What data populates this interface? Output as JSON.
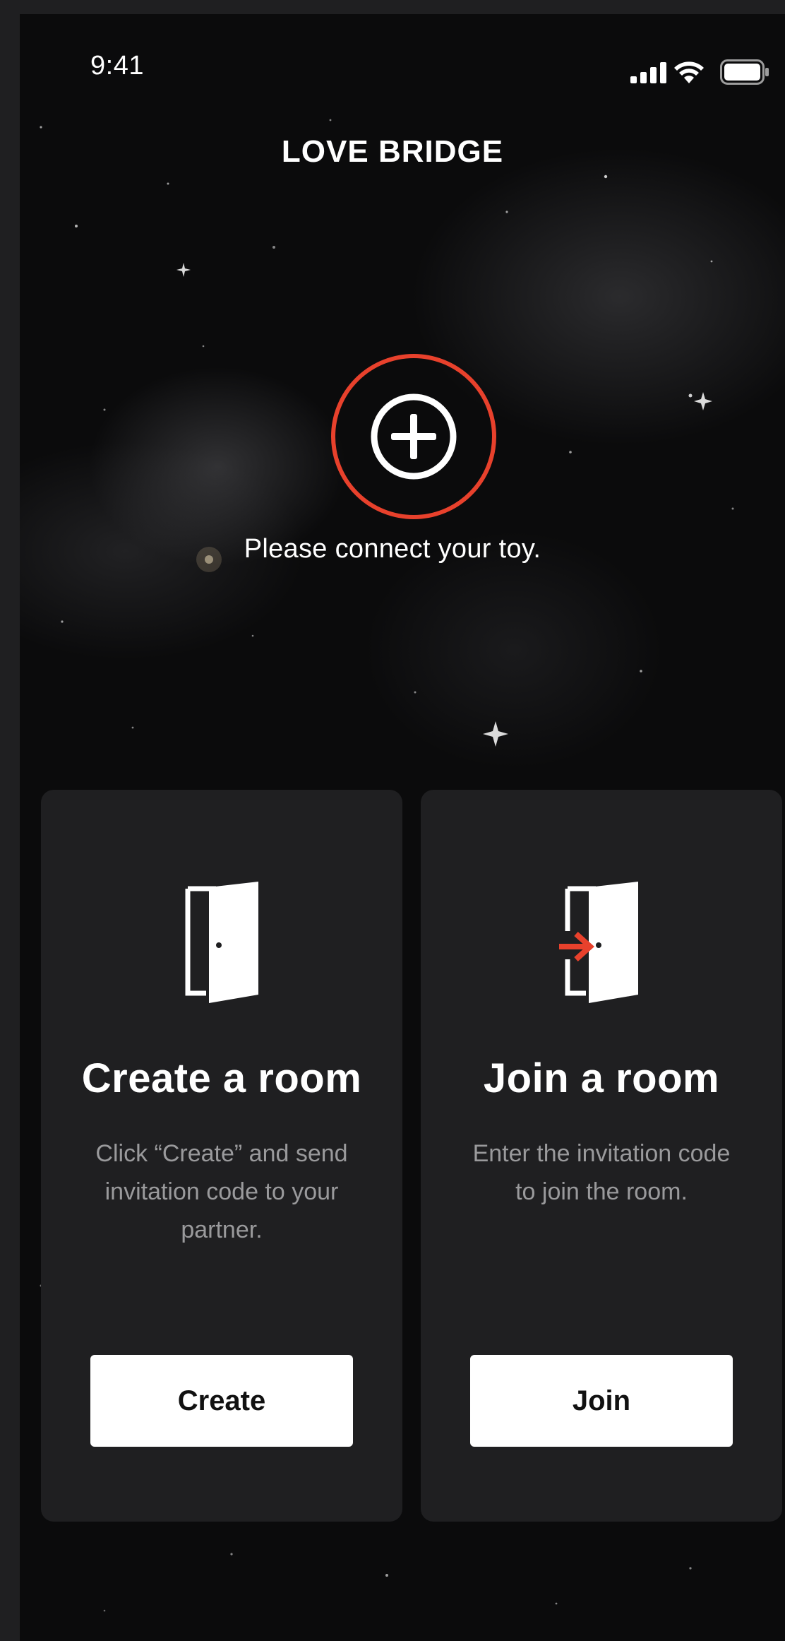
{
  "status_bar": {
    "time": "9:41"
  },
  "header": {
    "title": "LOVE BRIDGE"
  },
  "connect": {
    "message": "Please connect your toy."
  },
  "cards": {
    "create": {
      "title": "Create a room",
      "description": "Click “Create” and send invitation code to your partner.",
      "button_label": "Create"
    },
    "join": {
      "title": "Join a room",
      "description": "Enter the invitation code to join the room.",
      "button_label": "Join"
    }
  },
  "icons": {
    "connect": "plus-circle-icon",
    "create_room": "door-icon",
    "join_room": "door-enter-icon"
  },
  "colors": {
    "accent": "#e8412c",
    "background": "#0b0b0c",
    "card": "#1f1f21",
    "button": "#ffffff",
    "muted_text": "#9a9a9c"
  }
}
